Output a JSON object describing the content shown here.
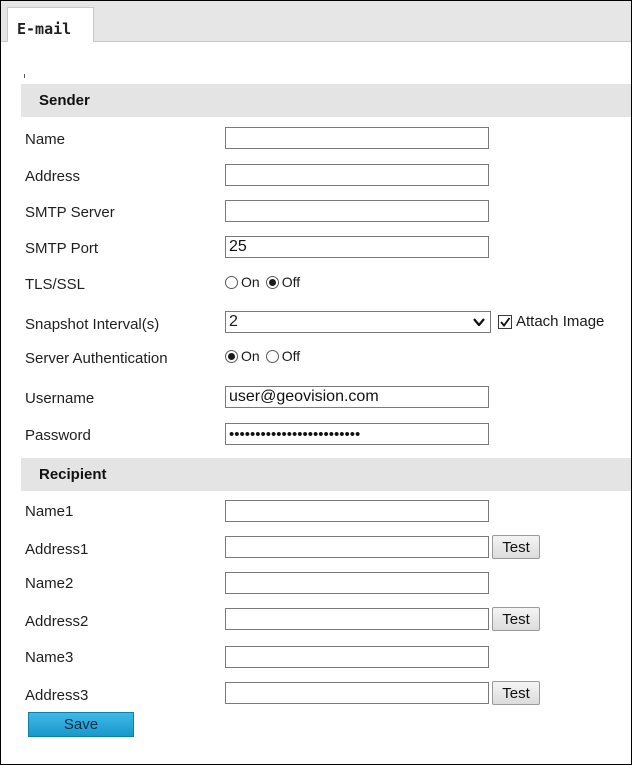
{
  "tab": {
    "label": "E-mail"
  },
  "sender": {
    "heading": "Sender",
    "name_label": "Name",
    "name_value": "",
    "address_label": "Address",
    "address_value": "",
    "smtp_server_label": "SMTP Server",
    "smtp_server_value": "",
    "smtp_port_label": "SMTP Port",
    "smtp_port_value": "25",
    "tls_label": "TLS/SSL",
    "tls_on": "On",
    "tls_off": "Off",
    "tls_selected": "Off",
    "snapshot_label": "Snapshot Interval(s)",
    "snapshot_value": "2",
    "attach_label": "Attach Image",
    "attach_checked": true,
    "auth_label": "Server Authentication",
    "auth_on": "On",
    "auth_off": "Off",
    "auth_selected": "On",
    "username_label": "Username",
    "username_value": "user@geovision.com",
    "password_label": "Password",
    "password_value": "•••••••••••••••••••••••••"
  },
  "recipient": {
    "heading": "Recipient",
    "name1_label": "Name1",
    "address1_label": "Address1",
    "name2_label": "Name2",
    "address2_label": "Address2",
    "name3_label": "Name3",
    "address3_label": "Address3",
    "test_label": "Test"
  },
  "save_label": "Save"
}
